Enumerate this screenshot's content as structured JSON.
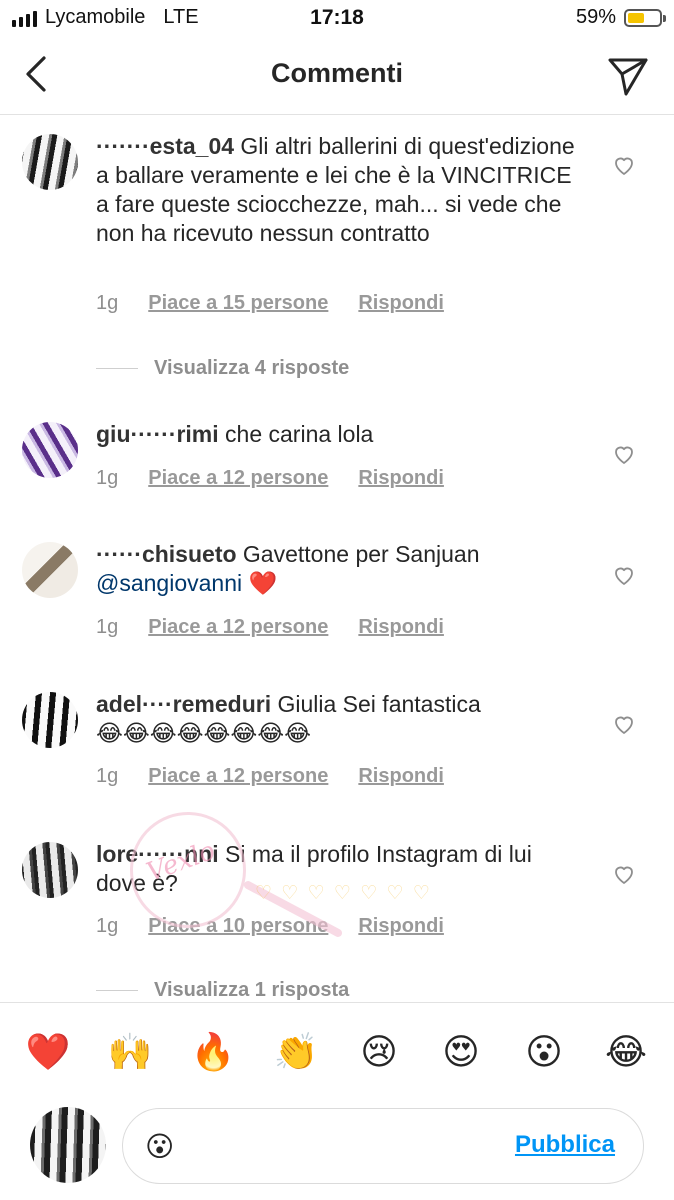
{
  "status_bar": {
    "carrier": "Lycamobile",
    "network": "LTE",
    "time": "17:18",
    "battery": "59%",
    "battery_level": 0.59,
    "battery_color": "#f5c400"
  },
  "header": {
    "title": "Commenti",
    "back_icon": "chevron-left-icon",
    "send_icon": "paper-plane-icon"
  },
  "comments": [
    {
      "username": "·······esta_04",
      "text": "Gli altri ballerini di quest'edizione a ballare veramente e lei che è la VINCITRICE a fare queste sciocchezze, mah... si vede che non ha ricevuto nessun contratto",
      "age": "1g",
      "likes": "Piace a 15 persone",
      "reply": "Rispondi",
      "view_replies": "Visualizza 4 risposte"
    },
    {
      "username": "giu······rimi",
      "text": "che carina lola",
      "age": "1g",
      "likes": "Piace a 12 persone",
      "reply": "Rispondi"
    },
    {
      "username": "······chisueto",
      "text": "Gavettone per Sanjuan",
      "mention": "@sangiovanni",
      "emoji": "❤️",
      "age": "1g",
      "likes": "Piace a 12 persone",
      "reply": "Rispondi"
    },
    {
      "username": "adel····remeduri",
      "text": "Giulia Sei fantastica",
      "emoji": "😂😂😂😂😂😂😂😂",
      "age": "1g",
      "likes": "Piace a 12 persone",
      "reply": "Rispondi"
    },
    {
      "username": "lore······nni",
      "text": "Si ma il profilo Instagram di lui dove è?",
      "age": "1g",
      "likes": "Piace a 10 persone",
      "reply": "Rispondi",
      "view_replies": "Visualizza 1 risposta"
    }
  ],
  "emoji_bar": [
    "❤️",
    "🙌",
    "🔥",
    "👏",
    "😢",
    "😍",
    "😮",
    "😂"
  ],
  "composer": {
    "value": "😮",
    "publish_label": "Pubblica"
  },
  "colors": {
    "link": "#0095f6",
    "mention": "#00376b",
    "secondary_text": "#8e8e8e"
  }
}
